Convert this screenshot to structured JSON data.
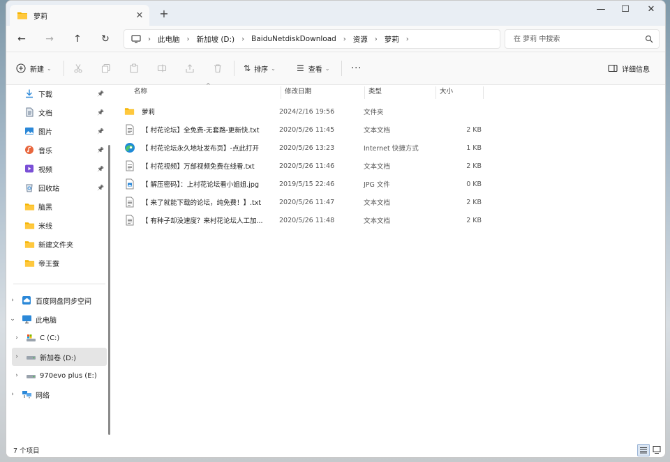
{
  "window": {
    "tab_label": "萝莉",
    "tab_close": "✕",
    "new_tab": "+",
    "minimize": "—",
    "maximize": "☐",
    "close": "✕"
  },
  "nav": {
    "back": "←",
    "forward": "→",
    "up": "↑",
    "refresh": "↻",
    "breadcrumbs": [
      "此电脑",
      "新加坡 (D:)",
      "BaiduNetdiskDownload",
      "资源",
      "萝莉"
    ],
    "search_placeholder": "在 萝莉 中搜索"
  },
  "toolbar": {
    "new_label": "新建",
    "sort_label": "排序",
    "view_label": "查看",
    "more_label": "···",
    "details_label": "详细信息"
  },
  "sidebar": {
    "quick": [
      {
        "label": "下载",
        "icon": "download-icon",
        "color": "#2b88d8"
      },
      {
        "label": "文档",
        "icon": "document-icon",
        "color": "#6b7c93"
      },
      {
        "label": "图片",
        "icon": "pictures-icon",
        "color": "#2b88d8"
      },
      {
        "label": "音乐",
        "icon": "music-icon",
        "color": "#e8663d"
      },
      {
        "label": "视频",
        "icon": "video-icon",
        "color": "#7a4fd6"
      },
      {
        "label": "回收站",
        "icon": "recycle-bin-icon",
        "color": "#6b7c93"
      },
      {
        "label": "脑黑",
        "icon": "folder-icon",
        "color": "#f4b400"
      },
      {
        "label": "米线",
        "icon": "folder-icon",
        "color": "#f4b400"
      },
      {
        "label": "新建文件夹",
        "icon": "folder-icon",
        "color": "#f4b400"
      },
      {
        "label": "帝王蚕",
        "icon": "folder-icon",
        "color": "#f4b400"
      }
    ],
    "tree": [
      {
        "label": "百度网盘同步空间",
        "icon": "cloud-sync-icon",
        "chevron": "›"
      },
      {
        "label": "此电脑",
        "icon": "computer-icon",
        "chevron": "⌄"
      },
      {
        "label": "C (C:)",
        "icon": "drive-c-icon",
        "chevron": "›"
      },
      {
        "label": "新加卷 (D:)",
        "icon": "drive-icon",
        "chevron": "›"
      },
      {
        "label": "970evo plus (E:)",
        "icon": "drive-icon",
        "chevron": "›"
      },
      {
        "label": "网络",
        "icon": "network-icon",
        "chevron": "›"
      }
    ]
  },
  "columns": {
    "name": "名称",
    "date": "修改日期",
    "type": "类型",
    "size": "大小"
  },
  "files": [
    {
      "name": "萝莉",
      "date": "2024/2/16 19:56",
      "type": "文件夹",
      "size": "",
      "icon": "folder-icon"
    },
    {
      "name": "【 村花论坛】全免费-无套路-更新快.txt",
      "date": "2020/5/26 11:45",
      "type": "文本文档",
      "size": "2 KB",
      "icon": "text-file-icon"
    },
    {
      "name": "【 村花论坛永久地址发布页】-点此打开",
      "date": "2020/5/26 13:23",
      "type": "Internet 快捷方式",
      "size": "1 KB",
      "icon": "edge-icon"
    },
    {
      "name": "【 村花视频】万部视频免费在线看.txt",
      "date": "2020/5/26 11:46",
      "type": "文本文档",
      "size": "2 KB",
      "icon": "text-file-icon"
    },
    {
      "name": "【 解压密码】：上村花论坛看小姐姐.jpg",
      "date": "2019/5/15 22:46",
      "type": "JPG 文件",
      "size": "0 KB",
      "icon": "image-file-icon"
    },
    {
      "name": "【 来了就能下载的论坛，纯免费！】.txt",
      "date": "2020/5/26 11:47",
      "type": "文本文档",
      "size": "2 KB",
      "icon": "text-file-icon"
    },
    {
      "name": "【 有种子却没速度？来村花论坛人工加...",
      "date": "2020/5/26 11:48",
      "type": "文本文档",
      "size": "2 KB",
      "icon": "text-file-icon"
    }
  ],
  "status": {
    "item_count": "7 个项目"
  }
}
